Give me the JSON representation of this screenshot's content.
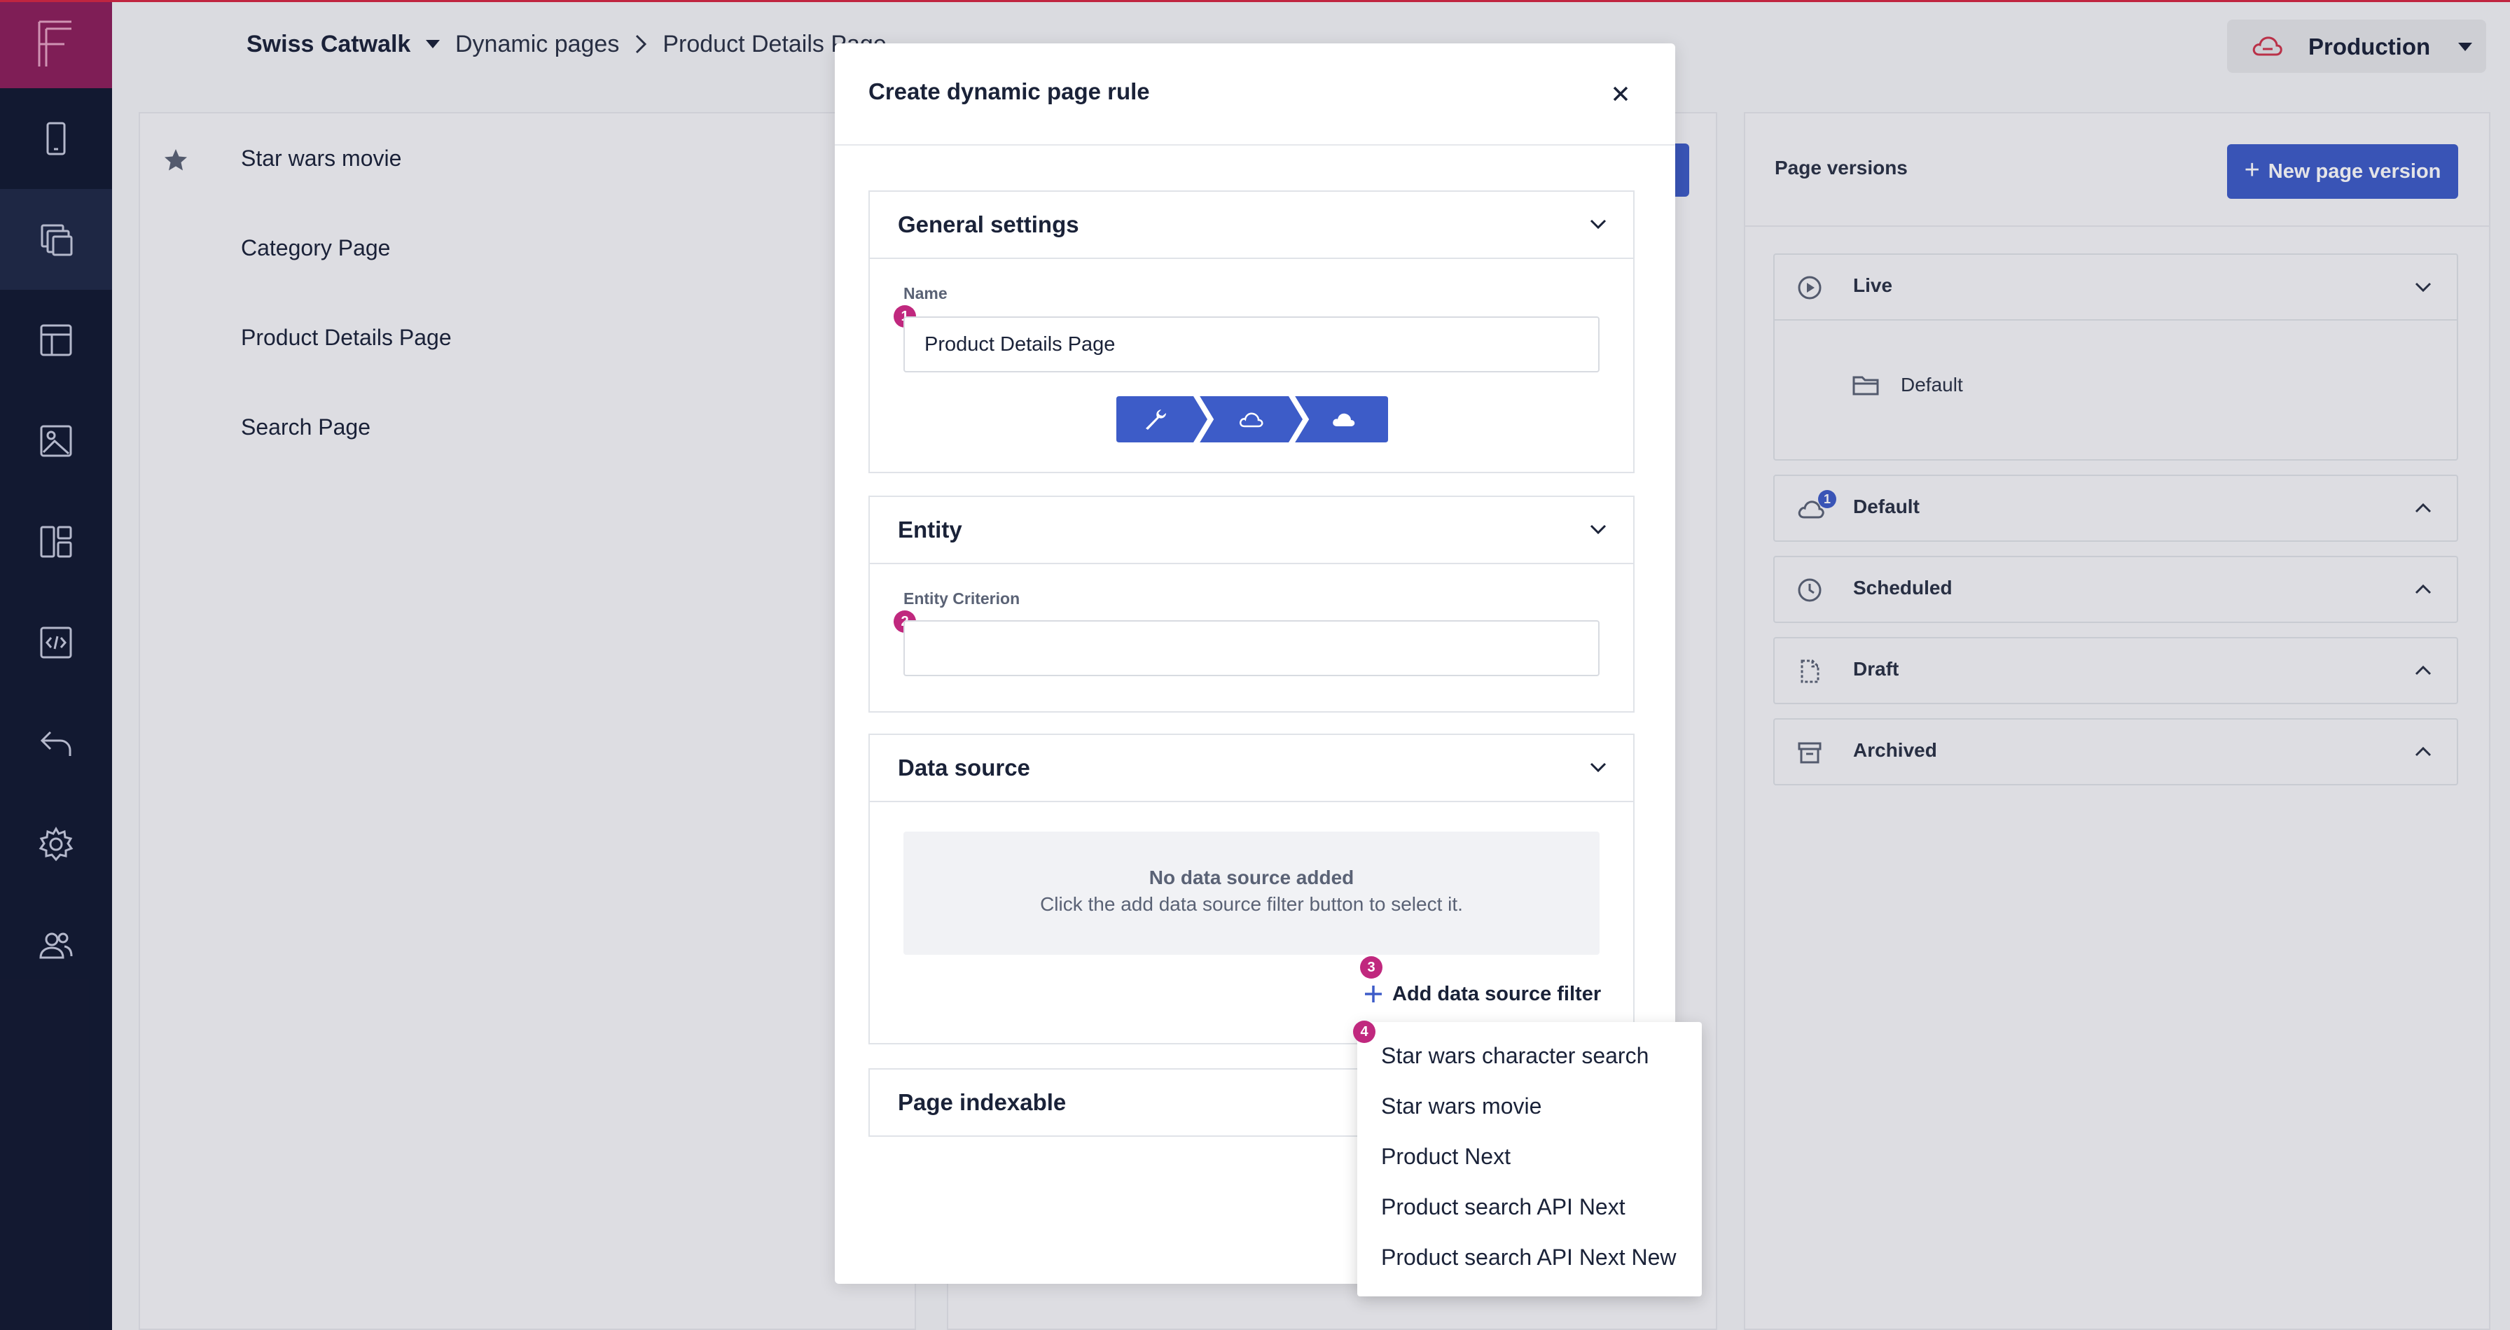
{
  "topbar": {
    "project_name": "Swiss Catwalk",
    "breadcrumb": [
      "Dynamic pages",
      "Product Details Page"
    ],
    "environment": "Production"
  },
  "sidebar": {
    "items": [
      {
        "icon": "mobile-icon"
      },
      {
        "icon": "pages-icon",
        "active": true
      },
      {
        "icon": "layout-icon"
      },
      {
        "icon": "media-icon"
      },
      {
        "icon": "components-icon"
      },
      {
        "icon": "code-icon"
      },
      {
        "icon": "undo-icon"
      },
      {
        "icon": "settings-icon"
      },
      {
        "icon": "users-icon"
      }
    ]
  },
  "pages_list": {
    "items": [
      {
        "label": "Star wars movie",
        "starred": true
      },
      {
        "label": "Category Page"
      },
      {
        "label": "Product Details Page"
      },
      {
        "label": "Search Page"
      }
    ]
  },
  "page_versions": {
    "title": "Page versions",
    "new_version_label": "New page version",
    "groups": [
      {
        "label": "Live",
        "expanded": true,
        "item": "Default"
      },
      {
        "label": "Default",
        "badge": "1"
      },
      {
        "label": "Scheduled"
      },
      {
        "label": "Draft"
      },
      {
        "label": "Archived"
      }
    ]
  },
  "modal": {
    "title": "Create dynamic page rule",
    "general": {
      "title": "General settings",
      "name_label": "Name",
      "name_value": "Product Details Page",
      "marker": "1"
    },
    "entity": {
      "title": "Entity",
      "criterion_label": "Entity Criterion",
      "criterion_value": "",
      "marker": "2"
    },
    "datasource": {
      "title": "Data source",
      "empty_title": "No data source added",
      "empty_desc": "Click the add data source filter button to select it.",
      "add_label": "Add data source filter",
      "marker": "3"
    },
    "indexable": {
      "title": "Page indexable"
    }
  },
  "dropdown": {
    "marker": "4",
    "items": [
      "Star wars character search",
      "Star wars movie",
      "Product Next",
      "Product search API Next",
      "Product search API Next New"
    ]
  },
  "colors": {
    "primary": "#3d5cc8",
    "sidebar": "#111830",
    "logo": "#8c1e5a",
    "step_marker": "#c0287e",
    "cloud_accent": "#d0344a"
  }
}
